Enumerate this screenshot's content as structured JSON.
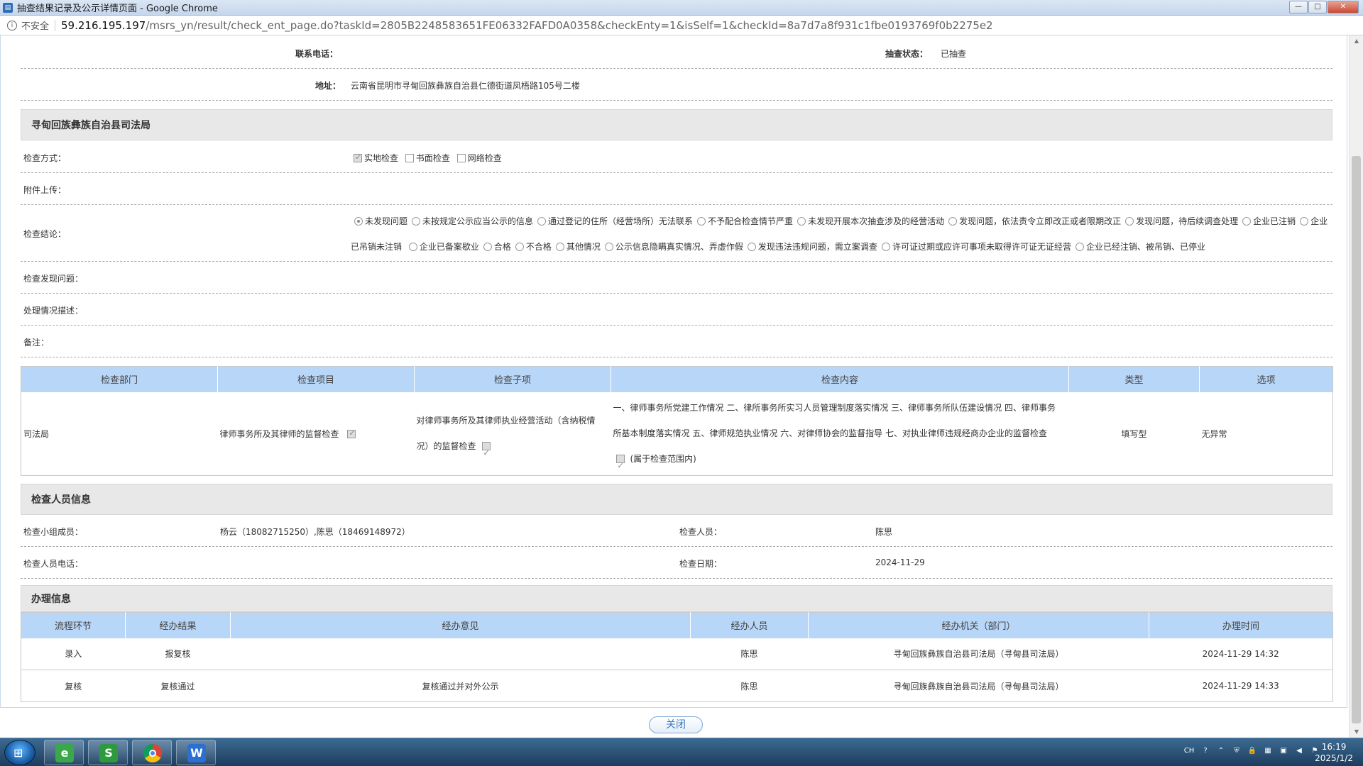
{
  "window": {
    "title": "抽查结果记录及公示详情页面 - Google Chrome",
    "minimize": "—",
    "maximize": "□",
    "close": "✕"
  },
  "addressbar": {
    "security": "不安全",
    "host": "59.216.195.197",
    "path": "/msrs_yn/result/check_ent_page.do?taskId=2805B2248583651FE06332FAFD0A0358&checkEnty=1&isSelf=1&checkId=8a7d7a8f931c1fbe0193769f0b2275e2"
  },
  "info": {
    "phone_label": "联系电话：",
    "phone_value": "",
    "status_label": "抽查状态：",
    "status_value": "已抽查",
    "address_label": "地址：",
    "address_value": "云南省昆明市寻甸回族彝族自治县仁德街道凤梧路105号二楼"
  },
  "department": {
    "title": "寻甸回族彝族自治县司法局",
    "method_label": "检查方式：",
    "methods": [
      {
        "label": "实地检查",
        "checked": true
      },
      {
        "label": "书面检查",
        "checked": false
      },
      {
        "label": "网络检查",
        "checked": false
      }
    ],
    "attachment_label": "附件上传：",
    "conclusion_label": "检查结论：",
    "conclusions_line1": [
      {
        "label": "未发现问题",
        "checked": true
      },
      {
        "label": "未按规定公示应当公示的信息",
        "checked": false
      },
      {
        "label": "通过登记的住所（经营场所）无法联系",
        "checked": false
      },
      {
        "label": "不予配合检查情节严重",
        "checked": false
      },
      {
        "label": "未发现开展本次抽查涉及的经营活动",
        "checked": false
      },
      {
        "label": "发现问题，依法责令立即改正或者限期改正",
        "checked": false
      },
      {
        "label": "发现问题，待后续调查处理",
        "checked": false
      },
      {
        "label": "企业已注销",
        "checked": false
      },
      {
        "label": "企业",
        "checked": false
      }
    ],
    "conclusions_line2_lead": "已吊销未注销",
    "conclusions_line2": [
      {
        "label": "企业已备案歇业",
        "checked": false
      },
      {
        "label": "合格",
        "checked": false
      },
      {
        "label": "不合格",
        "checked": false
      },
      {
        "label": "其他情况",
        "checked": false
      },
      {
        "label": "公示信息隐瞒真实情况、弄虚作假",
        "checked": false
      },
      {
        "label": "发现违法违规问题，需立案调查",
        "checked": false
      },
      {
        "label": "许可证过期或应许可事项未取得许可证无证经营",
        "checked": false
      },
      {
        "label": "企业已经注销、被吊销、已停业",
        "checked": false
      }
    ],
    "found_label": "检查发现问题：",
    "handling_label": "处理情况描述：",
    "remark_label": "备注："
  },
  "check_table": {
    "headers": [
      "检查部门",
      "检查项目",
      "检查子项",
      "检查内容",
      "类型",
      "选项"
    ],
    "row": {
      "dept": "司法局",
      "item": "律师事务所及其律师的监督检查",
      "sub_line1": "对律师事务所及其律师执业经营活动（含纳税情",
      "sub_line2": "况）的监督检查",
      "content_line1": "一、律师事务所党建工作情况 二、律所事务所实习人员管理制度落实情况 三、律师事务所队伍建设情况 四、律师事务",
      "content_line2": "所基本制度落实情况 五、律师规范执业情况 六、对律师协会的监督指导 七、对执业律师违规经商办企业的监督检查",
      "content_line3": "(属于检查范围内)",
      "type": "填写型",
      "option": "无异常"
    }
  },
  "inspectors": {
    "title": "检查人员信息",
    "team_label": "检查小组成员：",
    "team_value": "杨云（18082715250）,陈思（18469148972）",
    "person_label": "检查人员：",
    "person_value": "陈思",
    "phone_label": "检查人员电话：",
    "phone_value": "",
    "date_label": "检查日期：",
    "date_value": "2024-11-29"
  },
  "handling": {
    "title": "办理信息",
    "headers": [
      "流程环节",
      "经办结果",
      "经办意见",
      "经办人员",
      "经办机关（部门）",
      "办理时间"
    ],
    "rows": [
      [
        "录入",
        "报复核",
        "",
        "陈思",
        "寻甸回族彝族自治县司法局（寻甸县司法局）",
        "2024-11-29 14:32"
      ],
      [
        "复核",
        "复核通过",
        "复核通过并对外公示",
        "陈思",
        "寻甸回族彝族自治县司法局（寻甸县司法局）",
        "2024-11-29 14:33"
      ]
    ]
  },
  "close_button": "关闭",
  "taskbar": {
    "apps": [
      {
        "name": "ie-browser-icon",
        "glyph": "e",
        "color": "#3aa84a"
      },
      {
        "name": "wps-sheet-icon",
        "glyph": "S",
        "color": "#2e9a3e"
      },
      {
        "name": "chrome-icon",
        "glyph": "",
        "color": "#d94235"
      },
      {
        "name": "wps-writer-icon",
        "glyph": "W",
        "color": "#2a6fd1"
      }
    ],
    "lang": "CH",
    "time": "16:19",
    "date": "2025/1/2"
  }
}
